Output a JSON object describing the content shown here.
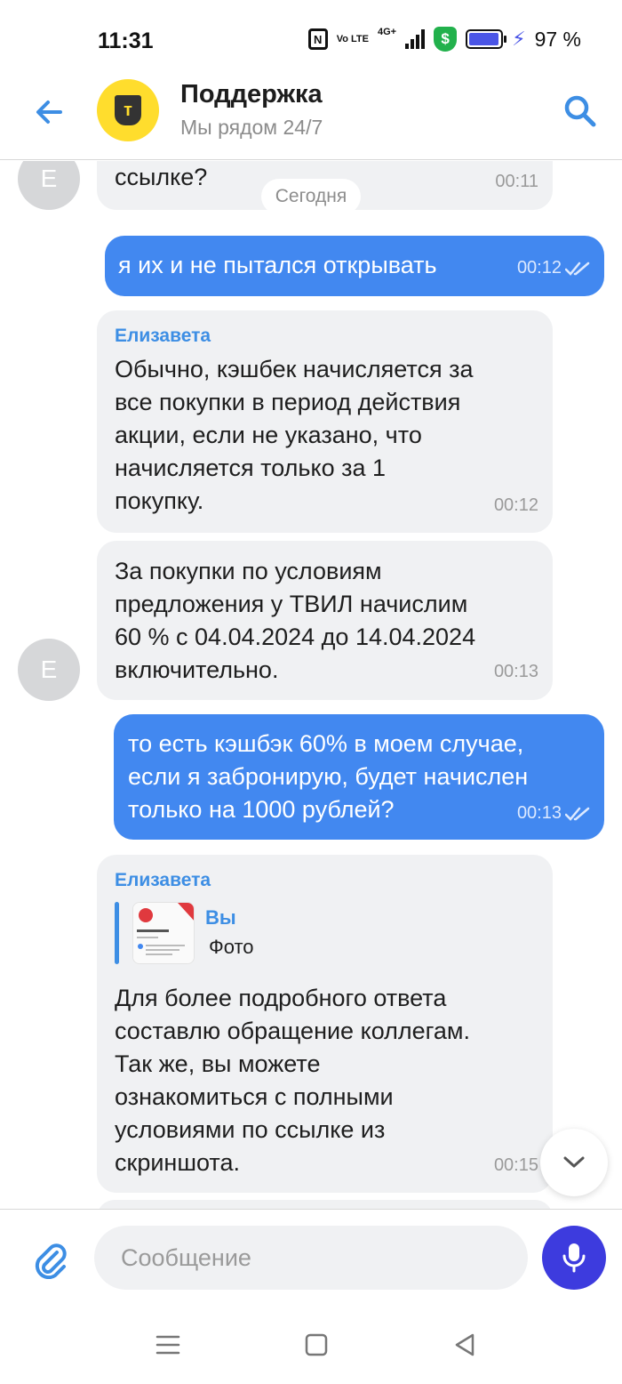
{
  "status_bar": {
    "time": "11:31",
    "network": "4G+",
    "volte": "Vo LTE",
    "battery_percent": "97 %",
    "battery_level": 0.97,
    "shield_symbol": "$",
    "nfc_symbol": "N",
    "charging": true
  },
  "header": {
    "title": "Поддержка",
    "subtitle": "Мы рядом 24/7",
    "logo_letter": "т",
    "logo_color": "#ffdd2d"
  },
  "chat": {
    "date_separator": "Сегодня",
    "avatar_initial": "Е",
    "messages": [
      {
        "direction": "in",
        "text": "ссылке?",
        "time": "00:11"
      },
      {
        "direction": "out",
        "text": "я их и не пытался открывать",
        "time": "00:12",
        "read": true
      },
      {
        "direction": "in",
        "sender": "Елизавета",
        "lines": [
          "Обычно, кэшбек начисляется за",
          "все покупки в период действия",
          "акции, если не указано, что",
          "начисляется только за 1",
          "покупку."
        ],
        "time": "00:12"
      },
      {
        "direction": "in",
        "lines": [
          "За покупки по условиям",
          "предложения у ТВИЛ начислим",
          "60 % с 04.04.2024 до 14.04.2024",
          "включительно."
        ],
        "time": "00:13"
      },
      {
        "direction": "out",
        "lines": [
          "то есть кэшбэк 60% в моем случае,",
          "если я забронирую, будет начислен",
          "только на 1000 рублей?"
        ],
        "time": "00:13",
        "read": true
      },
      {
        "direction": "in",
        "sender": "Елизавета",
        "reply": {
          "author": "Вы",
          "text": "Фото"
        },
        "lines": [
          "Для более подробного ответа",
          "составлю обращение коллегам.",
          "Так же, вы можете",
          "ознакомиться с полными",
          "условиями по ссылке из",
          "скриншота."
        ],
        "time": "00:15"
      }
    ]
  },
  "input": {
    "placeholder": "Сообщение"
  },
  "colors": {
    "accent": "#4288f0",
    "incoming_bubble": "#f0f1f3",
    "mic_button": "#3d3bde",
    "sender_name": "#3d8ee4"
  },
  "icons": {
    "back": "arrow-left-icon",
    "search": "search-icon",
    "attach": "paperclip-icon",
    "mic": "microphone-icon",
    "scroll_down": "chevron-down-icon",
    "nav_recents": "menu-lines-icon",
    "nav_home": "square-icon",
    "nav_back": "triangle-back-icon"
  }
}
